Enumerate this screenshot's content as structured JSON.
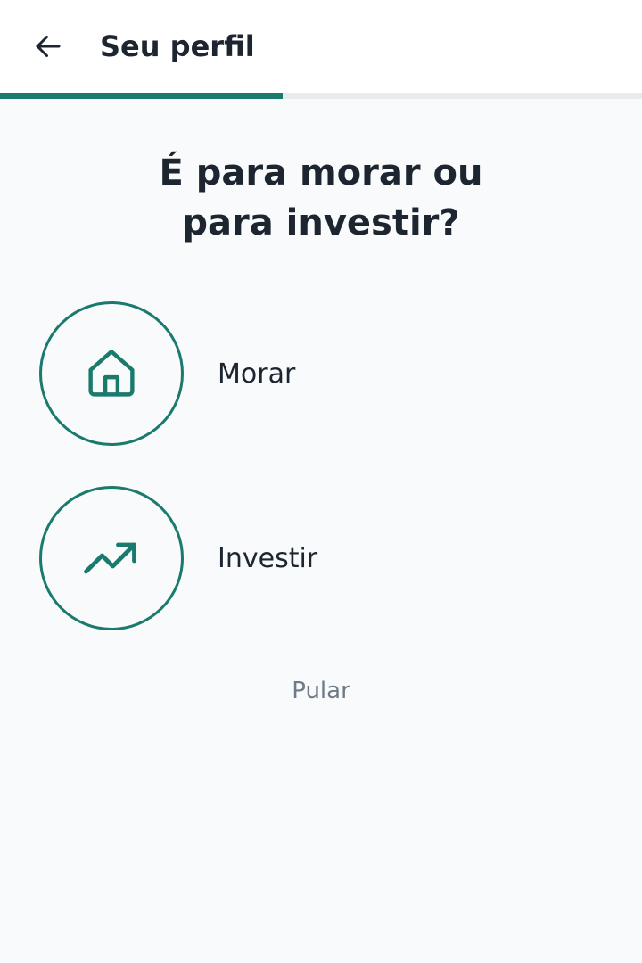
{
  "header": {
    "title": "Seu perfil",
    "back_icon": "arrow-left-icon"
  },
  "progress": {
    "fraction": 0.44,
    "color": "#1a7a6e"
  },
  "question": {
    "line1": "É para morar ou",
    "line2": "para investir?"
  },
  "options": [
    {
      "label": "Morar",
      "icon": "house-icon"
    },
    {
      "label": "Investir",
      "icon": "trending-up-icon"
    }
  ],
  "skip": {
    "label": "Pular"
  },
  "colors": {
    "accent": "#1a7a6e",
    "text": "#1d2630",
    "muted": "#6e7a85",
    "background": "#f8fafb"
  }
}
